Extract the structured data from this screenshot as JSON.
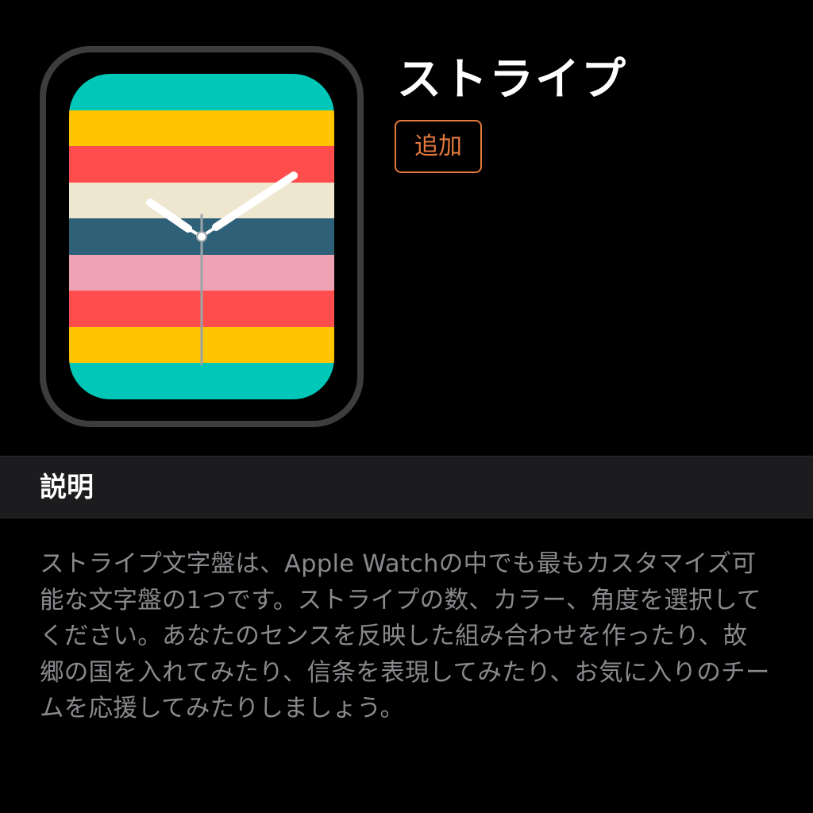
{
  "face": {
    "title": "ストライプ",
    "add_label": "追加",
    "accent_color": "#e57a3e",
    "stripe_colors": [
      "#00c7b7",
      "#ffc600",
      "#ff4d4d",
      "#efe6d0",
      "#2e6178",
      "#f0a2b5",
      "#ff4d4d",
      "#ffc600",
      "#00c7b7"
    ],
    "clock": {
      "hour_hand": "10",
      "minute_hand": "10"
    }
  },
  "description_section": {
    "title": "説明",
    "body": "ストライプ文字盤は、Apple Watchの中でも最もカスタマイズ可能な文字盤の1つです。ストライプの数、カラー、角度を選択してください。あなたのセンスを反映した組み合わせを作ったり、故郷の国を入れてみたり、信条を表現してみたり、お気に入りのチームを応援してみたりしましょう。"
  }
}
